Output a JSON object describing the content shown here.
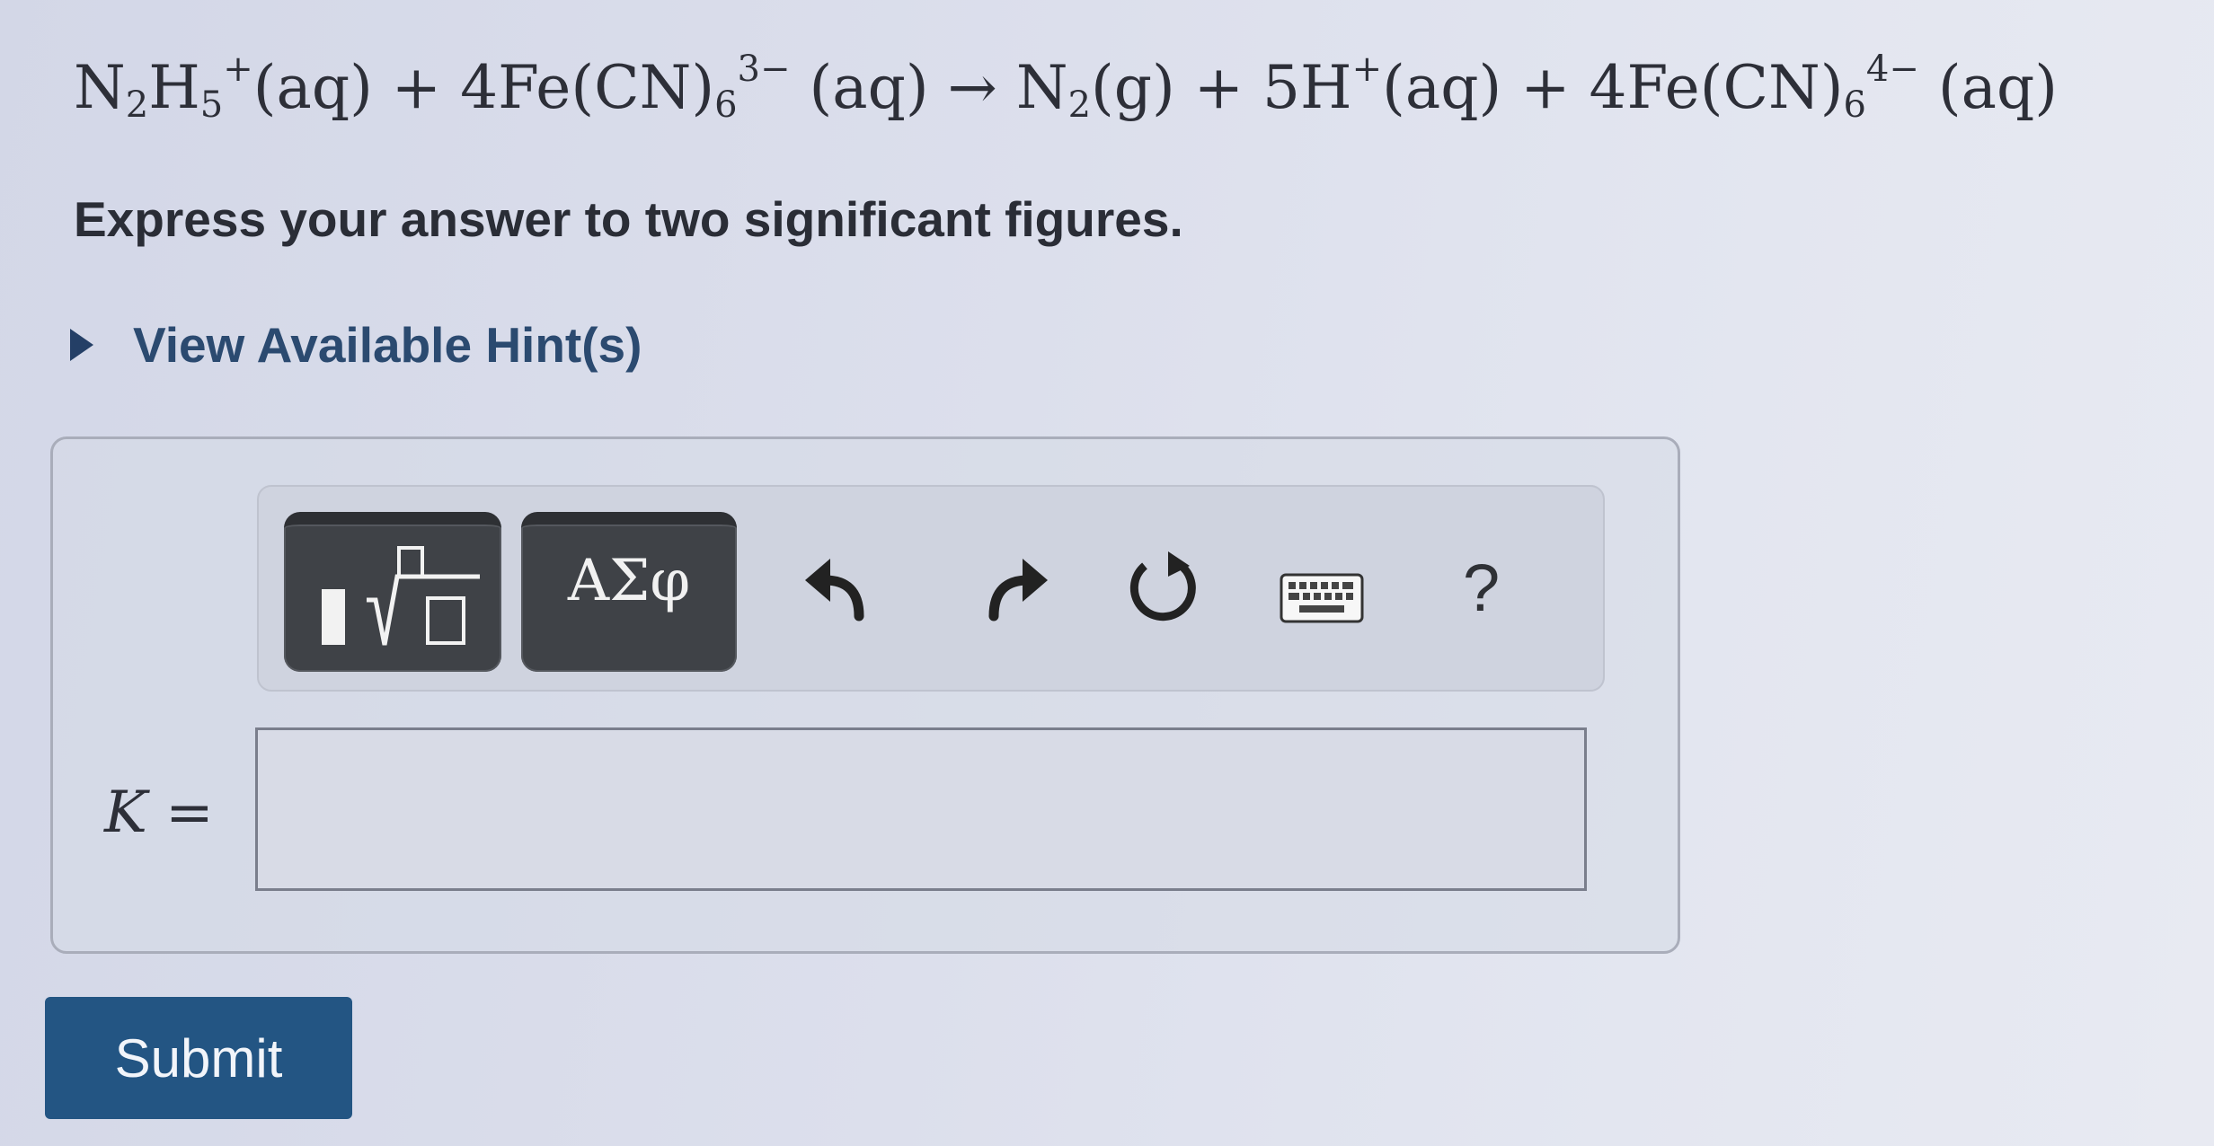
{
  "question": {
    "equation": {
      "n2h5_n": "N",
      "n2h5_n_sub": "2",
      "n2h5_h": "H",
      "n2h5_h_sub": "5",
      "n2h5_charge": "+",
      "aq1": "(aq) + 4Fe(CN)",
      "fecn_sub1": "6",
      "fecn_charge1": "3−",
      "aq2": " (aq) → N",
      "n2_sub": "2",
      "g_part": "(g) + 5H",
      "h_charge": "+",
      "aq3": "(aq) + 4Fe(CN)",
      "fecn_sub2": "6",
      "fecn_charge2": "4−",
      "aq4": " (aq)"
    },
    "instruction": "Express your answer to two significant figures.",
    "hint_link": "View Available Hint(s)"
  },
  "toolbar": {
    "greek_label": "ΑΣφ",
    "help_label": "?",
    "icons": [
      "templates-icon",
      "greek-symbols-icon",
      "undo-icon",
      "redo-icon",
      "reset-icon",
      "keyboard-icon",
      "help-icon"
    ]
  },
  "answer": {
    "variable": "K",
    "equals": " =",
    "value": ""
  },
  "submit_label": "Submit",
  "colors": {
    "link": "#2b4a70",
    "submit_bg": "#235583",
    "toolbar_button": "#3f4247"
  }
}
